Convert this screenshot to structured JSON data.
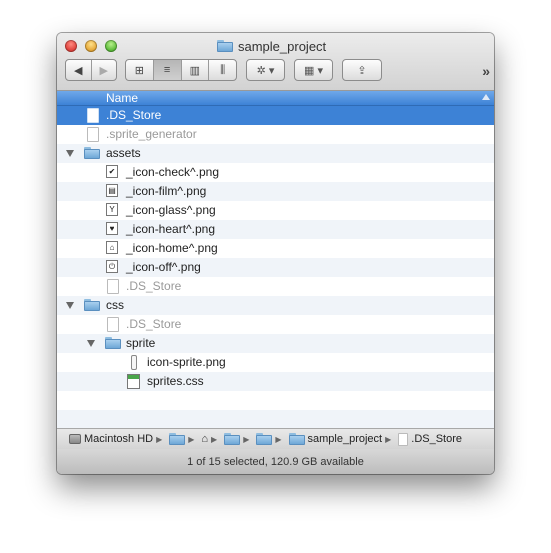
{
  "window": {
    "title": "sample_project"
  },
  "toolbar": {
    "back_icon": "◀",
    "forward_icon": "▶",
    "view_icons": [
      "⊞",
      "≡",
      "▥",
      "⫼"
    ],
    "action_icon": "✲ ▾",
    "arrange_icon": "▦ ▾",
    "share_icon": "⇪",
    "more_icon": "»"
  },
  "list_header": {
    "name_label": "Name"
  },
  "files": [
    {
      "name": ".DS_Store",
      "selected": true,
      "grey": false
    },
    {
      "name": ".sprite_generator",
      "grey": true
    },
    {
      "name": "assets"
    },
    {
      "name": "_icon-check^.png",
      "glyph": "✔"
    },
    {
      "name": "_icon-film^.png",
      "glyph": "▤"
    },
    {
      "name": "_icon-glass^.png",
      "glyph": "Y"
    },
    {
      "name": "_icon-heart^.png",
      "glyph": "♥"
    },
    {
      "name": "_icon-home^.png",
      "glyph": "⌂"
    },
    {
      "name": "_icon-off^.png",
      "glyph": "⏻"
    },
    {
      "name": ".DS_Store",
      "grey": true
    },
    {
      "name": "css"
    },
    {
      "name": ".DS_Store",
      "grey": true
    },
    {
      "name": "sprite"
    },
    {
      "name": "icon-sprite.png"
    },
    {
      "name": "sprites.css"
    }
  ],
  "pathbar": {
    "disk": "Macintosh HD",
    "folder": "sample_project",
    "file": ".DS_Store",
    "separator": "▶"
  },
  "status": {
    "text": "1 of 15 selected, 120.9 GB available"
  },
  "colors": {
    "selection": "#3d82d6",
    "alt_row": "#f0f4f9"
  }
}
